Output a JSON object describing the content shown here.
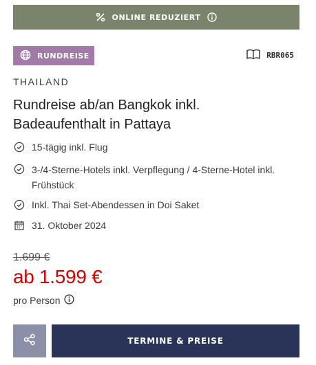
{
  "banner": {
    "label": "ONLINE REDUZIERT",
    "icon": "percent-icon",
    "info_icon": "info-icon"
  },
  "tag": {
    "label": "RUNDREISE",
    "icon": "globe-icon",
    "color": "#a17aa7"
  },
  "code": {
    "label": "RBR065",
    "icon": "book-icon"
  },
  "country": "THAILAND",
  "title": "Rundreise ab/an Bangkok inkl. Badeaufenthalt in Pattaya",
  "features": [
    {
      "text": "15-tägig inkl. Flug",
      "icon": "check-circle-icon"
    },
    {
      "text": "3-/4-Sterne-Hotels inkl. Verpflegung / 4-Sterne-Hotel inkl. Frühstück",
      "icon": "check-circle-icon"
    },
    {
      "text": "Inkl. Thai Set-Abendessen in Doi Saket",
      "icon": "check-circle-icon"
    },
    {
      "text": "31. Oktober 2024",
      "icon": "calendar-icon"
    }
  ],
  "price": {
    "old": "1.699 €",
    "current": "ab 1.599 €",
    "per": "pro Person",
    "current_color": "#d40000"
  },
  "actions": {
    "share_icon": "share-icon",
    "primary_label": "TERMINE & PREISE",
    "primary_color": "#2a3358"
  },
  "colors": {
    "banner": "#7a846a",
    "share": "#8b8fa8"
  }
}
